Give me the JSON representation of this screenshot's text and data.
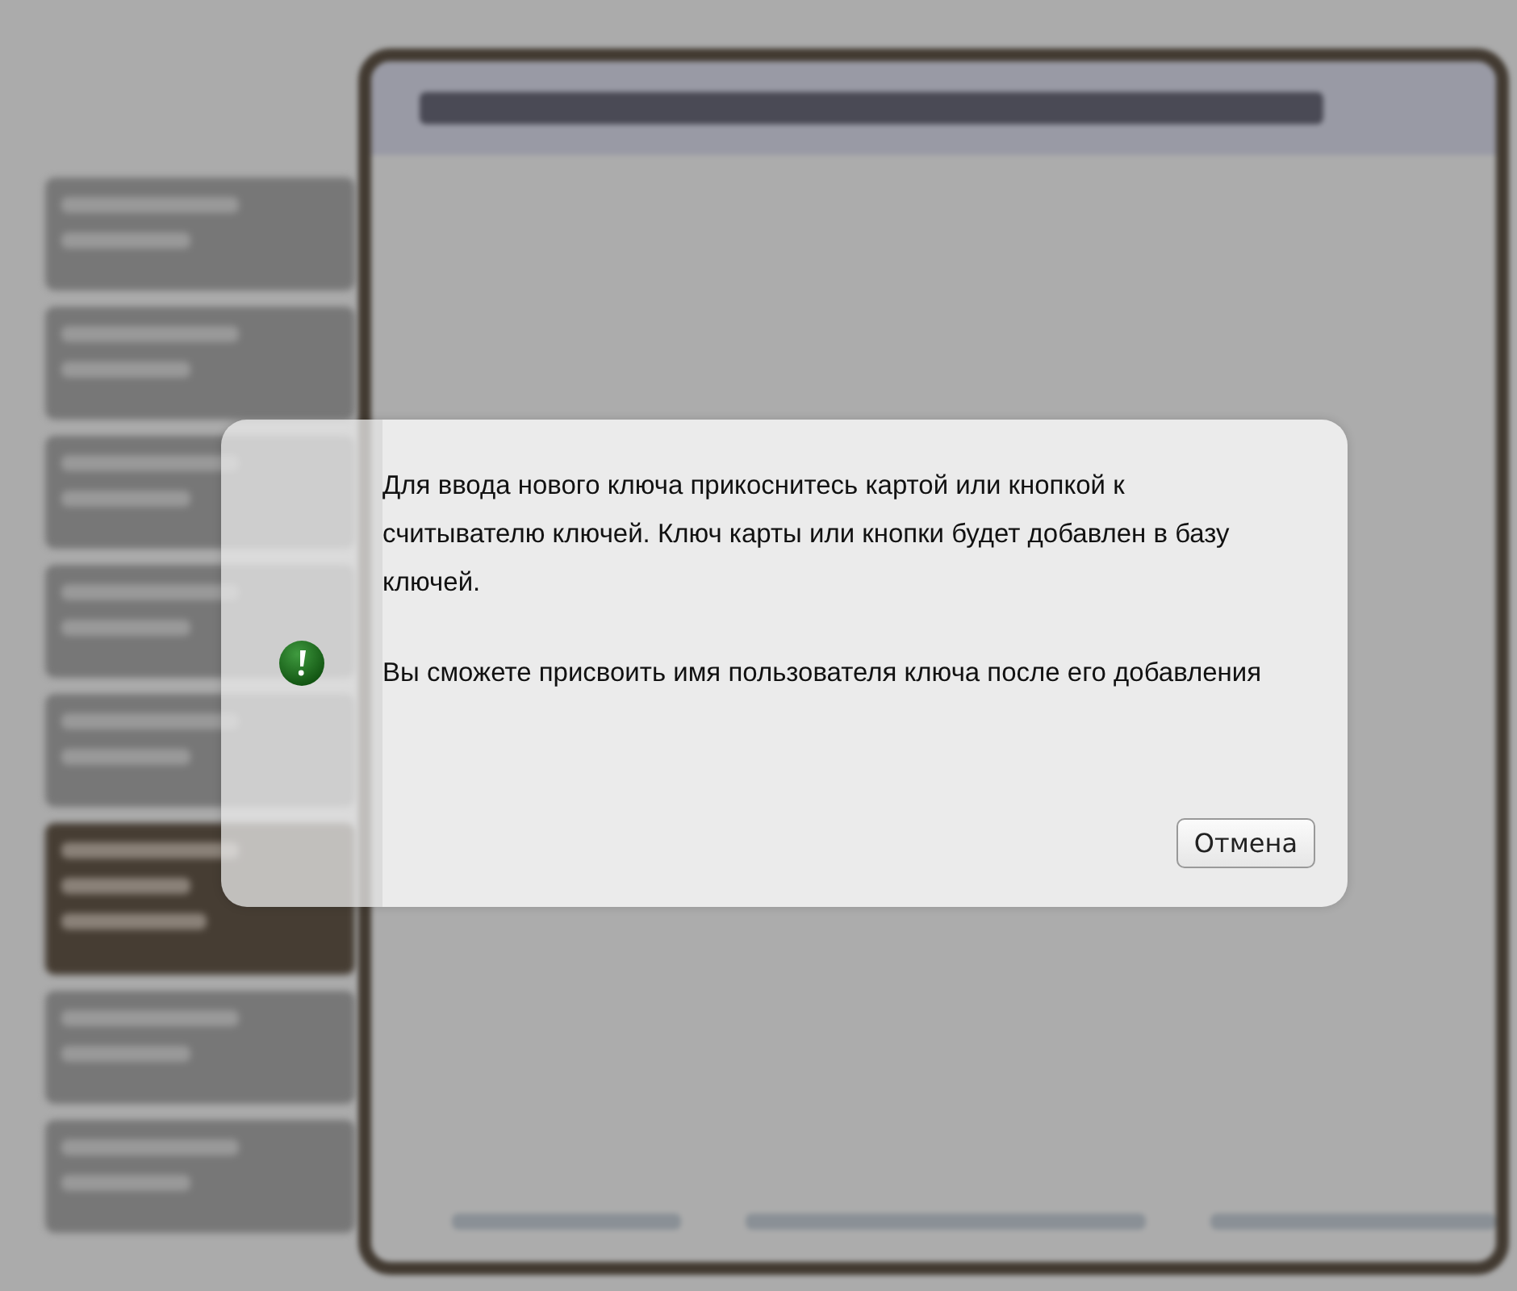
{
  "background": {
    "sidebar": {
      "items": [
        {
          "selected": false
        },
        {
          "selected": false
        },
        {
          "selected": false
        },
        {
          "selected": false
        },
        {
          "selected": false
        },
        {
          "selected": true
        },
        {
          "selected": false
        },
        {
          "selected": false
        }
      ]
    }
  },
  "dialog": {
    "paragraphs": [
      "Для ввода нового ключа прикоснитесь картой или кнопкой к считывателю ключей. Ключ карты или кнопки будет добавлен в базу ключей.",
      "Вы сможете присвоить имя пользователя ключа после его добавления"
    ],
    "buttons": [
      "Отмена"
    ]
  }
}
